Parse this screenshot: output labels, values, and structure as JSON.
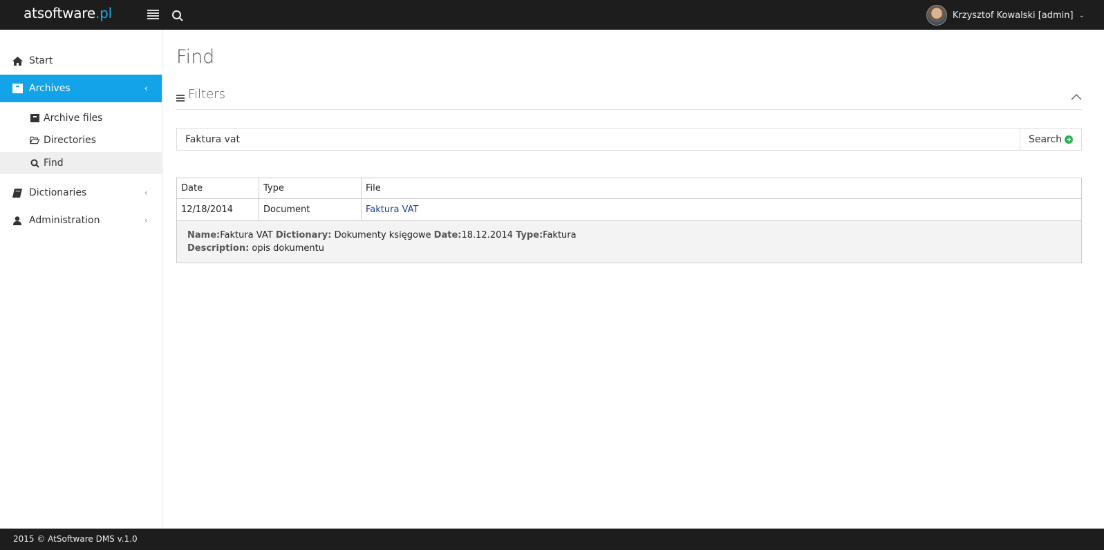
{
  "app": {
    "brand_main": "atsoftware",
    "brand_dot": ".pl",
    "user_label": "Krzysztof Kowalski [admin]"
  },
  "sidebar": {
    "items": [
      {
        "label": "Start",
        "icon": "home-icon"
      },
      {
        "label": "Archives",
        "icon": "archive-icon",
        "active": true
      },
      {
        "label": "Dictionaries",
        "icon": "book-icon"
      },
      {
        "label": "Administration",
        "icon": "user-icon"
      }
    ],
    "archives_sub": [
      {
        "label": "Archive files",
        "icon": "archive-box-icon"
      },
      {
        "label": "Directories",
        "icon": "folder-open-icon"
      },
      {
        "label": "Find",
        "icon": "search-icon",
        "current": true
      }
    ]
  },
  "page": {
    "title": "Find",
    "filters_title": "Filters"
  },
  "search": {
    "value": "Faktura vat",
    "button_label": "Search"
  },
  "results": {
    "columns": [
      "Date",
      "Type",
      "File"
    ],
    "rows": [
      {
        "date": "12/18/2014",
        "type": "Document",
        "file": "Faktura VAT",
        "details": {
          "name_label": "Name:",
          "name": "Faktura VAT",
          "dictionary_label": "Dictionary:",
          "dictionary": "Dokumenty księgowe",
          "date_label": "Date:",
          "date": "18.12.2014",
          "type_label": "Type:",
          "type": "Faktura",
          "description_label": "Description:",
          "description": "opis dokumentu"
        }
      }
    ]
  },
  "footer": {
    "text": "2015 © AtSoftware DMS v.1.0"
  },
  "colors": {
    "topbar": "#1d1d1d",
    "accent": "#13a3e8",
    "search_go": "#25b04d"
  }
}
